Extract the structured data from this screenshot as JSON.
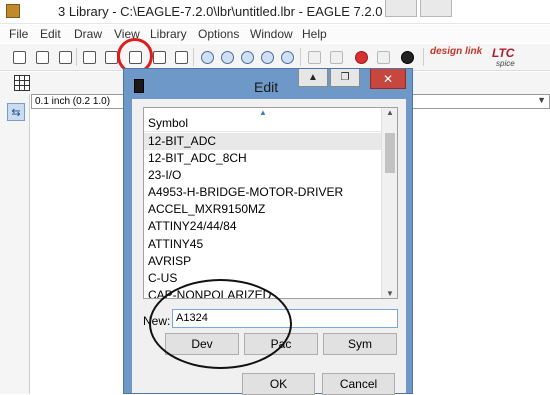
{
  "window": {
    "title": "3 Library - C:\\EAGLE-7.2.0\\lbr\\untitled.lbr - EAGLE 7.2.0 Li"
  },
  "menu": [
    "File",
    "Edit",
    "Draw",
    "View",
    "Library",
    "Options",
    "Window",
    "Help"
  ],
  "toolbar": {
    "icons": [
      "open-icon",
      "save-icon",
      "print-icon",
      "cam-icon",
      "board-icon",
      "device-package-symbol-icon",
      "dimension-icon",
      "window-icon",
      "zoom-fit-icon",
      "zoom-in-icon",
      "zoom-out-icon",
      "zoom-redraw-icon",
      "zoom-select-icon",
      "undo-icon",
      "redo-icon",
      "stop-icon",
      "go-icon",
      "help-icon"
    ],
    "brand_design_link": "design link",
    "brand_ltc": "LTC",
    "brand_ltc_sub": "spice"
  },
  "status": {
    "coord": "0.1 inch (0.2 1.0)"
  },
  "dialog": {
    "title": "Edit",
    "close_label": "✕",
    "list_header": "Symbol",
    "items": [
      "12-BIT_ADC",
      "12-BIT_ADC_8CH",
      "23-I/O",
      "A4953-H-BRIDGE-MOTOR-DRIVER",
      "ACCEL_MXR9150MZ",
      "ATTINY24/44/84",
      "ATTINY45",
      "AVRISP",
      "C-US",
      "CAP-NONPOLARIZED"
    ],
    "selected_index": 0,
    "new_label": "New:",
    "new_value": "A1324",
    "buttons": {
      "dev": "Dev",
      "pac": "Pac",
      "sym": "Sym",
      "ok": "OK",
      "cancel": "Cancel"
    }
  },
  "colors": {
    "dialog_frame": "#6d98c7",
    "close_button": "#c7463d",
    "highlight_ring": "#e01c1c"
  }
}
